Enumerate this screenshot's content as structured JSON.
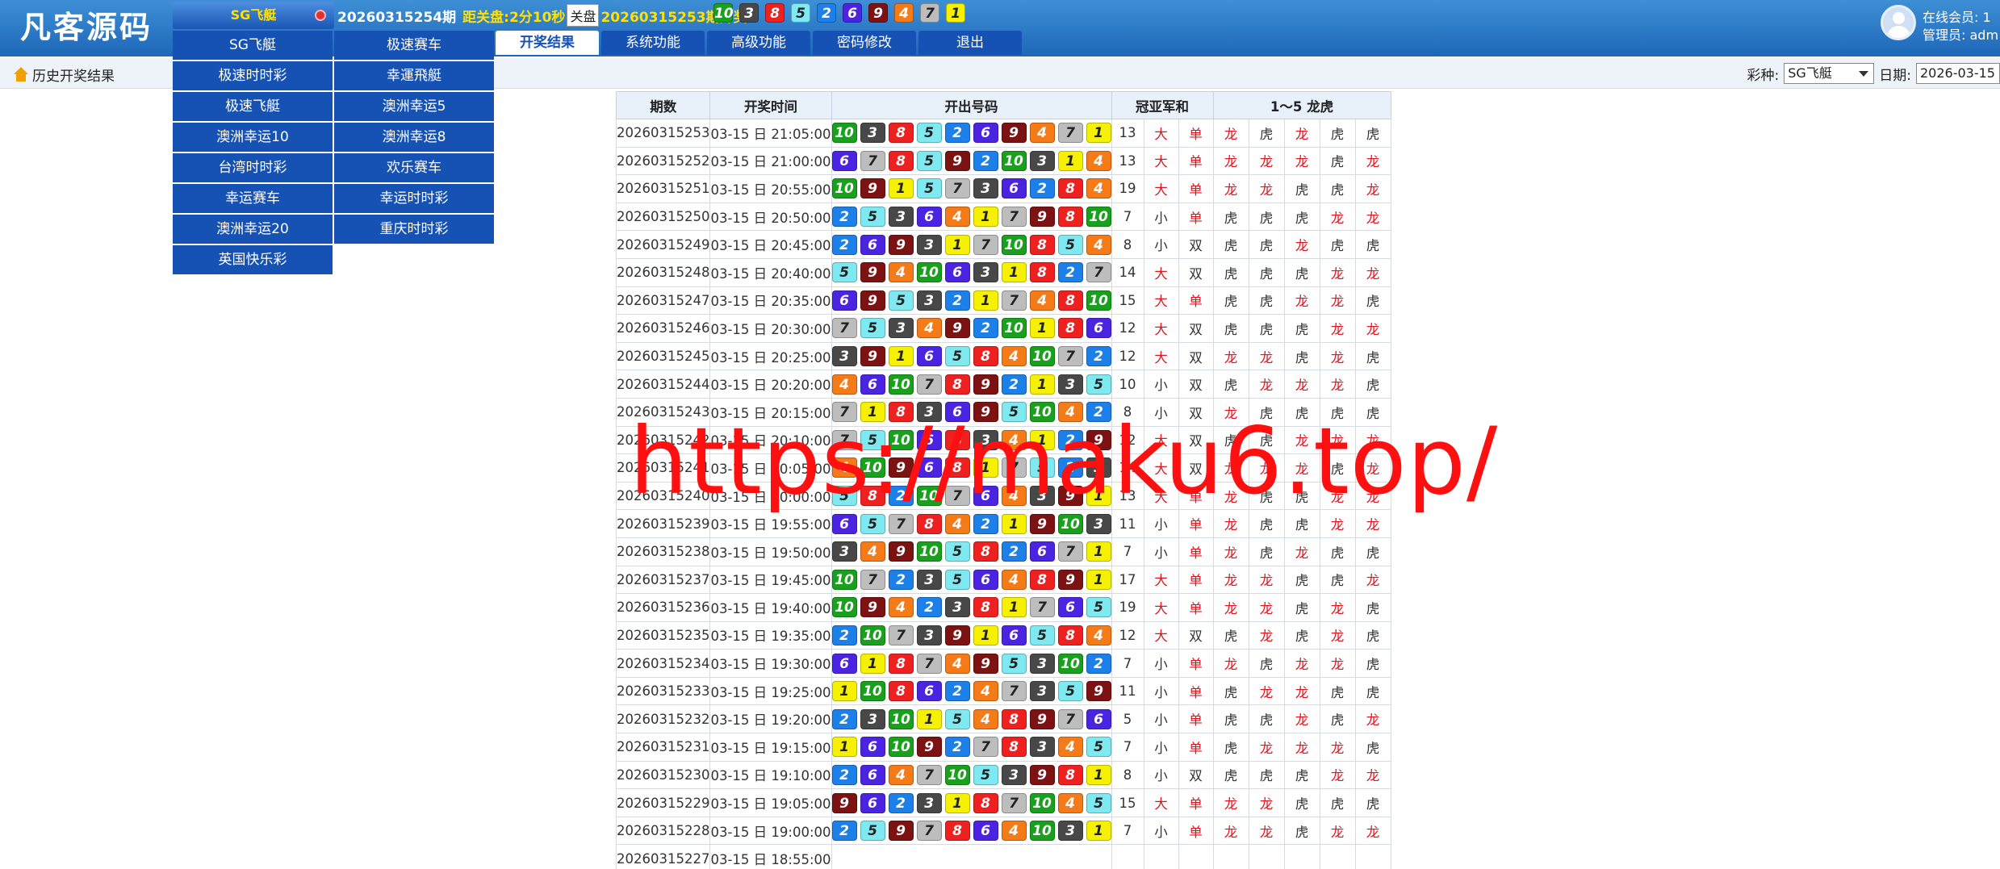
{
  "logo": "凡客源码",
  "header": {
    "game": "SG飞艇",
    "current_period": "20260315254期",
    "countdown_label": "距关盘:",
    "countdown": "2分10秒",
    "close_button": "关盘",
    "last_period": "20260315253期开奖:",
    "last_balls": [
      10,
      3,
      8,
      5,
      2,
      6,
      9,
      4,
      7,
      1
    ],
    "online_label": "在线会员: 1",
    "admin_label": "管理员: adm"
  },
  "nav": {
    "tabs": [
      "开奖结果",
      "系统功能",
      "高级功能",
      "密码修改",
      "退出"
    ],
    "active": 0
  },
  "subbar": {
    "history_link": "历史开奖结果",
    "lottery_label": "彩种:",
    "lottery_value": "SG飞艇",
    "date_label": "日期:",
    "date_value": "2026-03-15"
  },
  "dropdown": [
    "SG飞艇",
    "极速赛车",
    "极速时时彩",
    "幸運飛艇",
    "极速飞艇",
    "澳洲幸运5",
    "澳洲幸运10",
    "澳洲幸运8",
    "台湾时时彩",
    "欢乐赛车",
    "幸运赛车",
    "幸运时时彩",
    "澳洲幸运20",
    "重庆时时彩",
    "英国快乐彩"
  ],
  "table": {
    "headers": [
      "期数",
      "开奖时间",
      "开出号码",
      "冠亚军和",
      "1～5 龙虎"
    ]
  },
  "ball_colors": {
    "1": "#f6f100",
    "2": "#1d7fe8",
    "3": "#484848",
    "4": "#f57a18",
    "5": "#7ee9f0",
    "6": "#4b24e2",
    "7": "#bdbdbd",
    "8": "#ee2020",
    "9": "#7d1212",
    "10": "#19a01d"
  },
  "rows": [
    {
      "period": "20260315253",
      "time": "03-15 日 21:05:00",
      "balls": [
        10,
        3,
        8,
        5,
        2,
        6,
        9,
        4,
        7,
        1
      ],
      "sum": "13",
      "bs": "大",
      "oe": "单",
      "lh": [
        "龙",
        "虎",
        "龙",
        "虎",
        "虎"
      ]
    },
    {
      "period": "20260315252",
      "time": "03-15 日 21:00:00",
      "balls": [
        6,
        7,
        8,
        5,
        9,
        2,
        10,
        3,
        1,
        4
      ],
      "sum": "13",
      "bs": "大",
      "oe": "单",
      "lh": [
        "龙",
        "龙",
        "龙",
        "虎",
        "龙"
      ]
    },
    {
      "period": "20260315251",
      "time": "03-15 日 20:55:00",
      "balls": [
        10,
        9,
        1,
        5,
        7,
        3,
        6,
        2,
        8,
        4
      ],
      "sum": "19",
      "bs": "大",
      "oe": "单",
      "lh": [
        "龙",
        "龙",
        "虎",
        "虎",
        "龙"
      ]
    },
    {
      "period": "20260315250",
      "time": "03-15 日 20:50:00",
      "balls": [
        2,
        5,
        3,
        6,
        4,
        1,
        7,
        9,
        8,
        10
      ],
      "sum": "7",
      "bs": "小",
      "oe": "单",
      "lh": [
        "虎",
        "虎",
        "虎",
        "龙",
        "龙"
      ]
    },
    {
      "period": "20260315249",
      "time": "03-15 日 20:45:00",
      "balls": [
        2,
        6,
        9,
        3,
        1,
        7,
        10,
        8,
        5,
        4
      ],
      "sum": "8",
      "bs": "小",
      "oe": "双",
      "lh": [
        "虎",
        "虎",
        "龙",
        "虎",
        "虎"
      ]
    },
    {
      "period": "20260315248",
      "time": "03-15 日 20:40:00",
      "balls": [
        5,
        9,
        4,
        10,
        6,
        3,
        1,
        8,
        2,
        7
      ],
      "sum": "14",
      "bs": "大",
      "oe": "双",
      "lh": [
        "虎",
        "虎",
        "虎",
        "龙",
        "龙"
      ]
    },
    {
      "period": "20260315247",
      "time": "03-15 日 20:35:00",
      "balls": [
        6,
        9,
        5,
        3,
        2,
        1,
        7,
        4,
        8,
        10
      ],
      "sum": "15",
      "bs": "大",
      "oe": "单",
      "lh": [
        "虎",
        "虎",
        "龙",
        "龙",
        "虎"
      ]
    },
    {
      "period": "20260315246",
      "time": "03-15 日 20:30:00",
      "balls": [
        7,
        5,
        3,
        4,
        9,
        2,
        10,
        1,
        8,
        6
      ],
      "sum": "12",
      "bs": "大",
      "oe": "双",
      "lh": [
        "虎",
        "虎",
        "虎",
        "龙",
        "龙"
      ]
    },
    {
      "period": "20260315245",
      "time": "03-15 日 20:25:00",
      "balls": [
        3,
        9,
        1,
        6,
        5,
        8,
        4,
        10,
        7,
        2
      ],
      "sum": "12",
      "bs": "大",
      "oe": "双",
      "lh": [
        "龙",
        "龙",
        "虎",
        "龙",
        "虎"
      ]
    },
    {
      "period": "20260315244",
      "time": "03-15 日 20:20:00",
      "balls": [
        4,
        6,
        10,
        7,
        8,
        9,
        2,
        1,
        3,
        5
      ],
      "sum": "10",
      "bs": "小",
      "oe": "双",
      "lh": [
        "虎",
        "龙",
        "龙",
        "龙",
        "虎"
      ]
    },
    {
      "period": "20260315243",
      "time": "03-15 日 20:15:00",
      "balls": [
        7,
        1,
        8,
        3,
        6,
        9,
        5,
        10,
        4,
        2
      ],
      "sum": "8",
      "bs": "小",
      "oe": "双",
      "lh": [
        "龙",
        "虎",
        "虎",
        "虎",
        "虎"
      ]
    },
    {
      "period": "20260315242",
      "time": "03-15 日 20:10:00",
      "balls": [
        7,
        5,
        10,
        6,
        8,
        3,
        4,
        1,
        2,
        9
      ],
      "sum": "12",
      "bs": "大",
      "oe": "双",
      "lh": [
        "虎",
        "虎",
        "龙",
        "龙",
        "龙"
      ]
    },
    {
      "period": "20260315241",
      "time": "03-15 日 20:05:00",
      "balls": [
        4,
        10,
        9,
        6,
        8,
        1,
        7,
        5,
        2,
        3
      ],
      "sum": "14",
      "bs": "大",
      "oe": "双",
      "lh": [
        "龙",
        "龙",
        "龙",
        "虎",
        "龙"
      ]
    },
    {
      "period": "20260315240",
      "time": "03-15 日 20:00:00",
      "balls": [
        5,
        8,
        2,
        10,
        7,
        6,
        4,
        3,
        9,
        1
      ],
      "sum": "13",
      "bs": "大",
      "oe": "单",
      "lh": [
        "龙",
        "虎",
        "虎",
        "龙",
        "龙"
      ]
    },
    {
      "period": "20260315239",
      "time": "03-15 日 19:55:00",
      "balls": [
        6,
        5,
        7,
        8,
        4,
        2,
        1,
        9,
        10,
        3
      ],
      "sum": "11",
      "bs": "小",
      "oe": "单",
      "lh": [
        "龙",
        "虎",
        "虎",
        "龙",
        "龙"
      ]
    },
    {
      "period": "20260315238",
      "time": "03-15 日 19:50:00",
      "balls": [
        3,
        4,
        9,
        10,
        5,
        8,
        2,
        6,
        7,
        1
      ],
      "sum": "7",
      "bs": "小",
      "oe": "单",
      "lh": [
        "龙",
        "虎",
        "龙",
        "虎",
        "虎"
      ]
    },
    {
      "period": "20260315237",
      "time": "03-15 日 19:45:00",
      "balls": [
        10,
        7,
        2,
        3,
        5,
        6,
        4,
        8,
        9,
        1
      ],
      "sum": "17",
      "bs": "大",
      "oe": "单",
      "lh": [
        "龙",
        "龙",
        "虎",
        "虎",
        "龙"
      ]
    },
    {
      "period": "20260315236",
      "time": "03-15 日 19:40:00",
      "balls": [
        10,
        9,
        4,
        2,
        3,
        8,
        1,
        7,
        6,
        5
      ],
      "sum": "19",
      "bs": "大",
      "oe": "单",
      "lh": [
        "龙",
        "龙",
        "虎",
        "龙",
        "虎"
      ]
    },
    {
      "period": "20260315235",
      "time": "03-15 日 19:35:00",
      "balls": [
        2,
        10,
        7,
        3,
        9,
        1,
        6,
        5,
        8,
        4
      ],
      "sum": "12",
      "bs": "大",
      "oe": "双",
      "lh": [
        "虎",
        "龙",
        "虎",
        "龙",
        "虎"
      ]
    },
    {
      "period": "20260315234",
      "time": "03-15 日 19:30:00",
      "balls": [
        6,
        1,
        8,
        7,
        4,
        9,
        5,
        3,
        10,
        2
      ],
      "sum": "7",
      "bs": "小",
      "oe": "单",
      "lh": [
        "龙",
        "虎",
        "龙",
        "龙",
        "虎"
      ]
    },
    {
      "period": "20260315233",
      "time": "03-15 日 19:25:00",
      "balls": [
        1,
        10,
        8,
        6,
        2,
        4,
        7,
        3,
        5,
        9
      ],
      "sum": "11",
      "bs": "小",
      "oe": "单",
      "lh": [
        "虎",
        "龙",
        "龙",
        "虎",
        "虎"
      ]
    },
    {
      "period": "20260315232",
      "time": "03-15 日 19:20:00",
      "balls": [
        2,
        3,
        10,
        1,
        5,
        4,
        8,
        9,
        7,
        6
      ],
      "sum": "5",
      "bs": "小",
      "oe": "单",
      "lh": [
        "虎",
        "虎",
        "龙",
        "虎",
        "龙"
      ]
    },
    {
      "period": "20260315231",
      "time": "03-15 日 19:15:00",
      "balls": [
        1,
        6,
        10,
        9,
        2,
        7,
        8,
        3,
        4,
        5
      ],
      "sum": "7",
      "bs": "小",
      "oe": "单",
      "lh": [
        "虎",
        "龙",
        "龙",
        "龙",
        "虎"
      ]
    },
    {
      "period": "20260315230",
      "time": "03-15 日 19:10:00",
      "balls": [
        2,
        6,
        4,
        7,
        10,
        5,
        3,
        9,
        8,
        1
      ],
      "sum": "8",
      "bs": "小",
      "oe": "双",
      "lh": [
        "虎",
        "虎",
        "虎",
        "龙",
        "龙"
      ]
    },
    {
      "period": "20260315229",
      "time": "03-15 日 19:05:00",
      "balls": [
        9,
        6,
        2,
        3,
        1,
        8,
        7,
        10,
        4,
        5
      ],
      "sum": "15",
      "bs": "大",
      "oe": "单",
      "lh": [
        "龙",
        "龙",
        "虎",
        "虎",
        "虎"
      ]
    },
    {
      "period": "20260315228",
      "time": "03-15 日 19:00:00",
      "balls": [
        2,
        5,
        9,
        7,
        8,
        6,
        4,
        10,
        3,
        1
      ],
      "sum": "7",
      "bs": "小",
      "oe": "单",
      "lh": [
        "龙",
        "龙",
        "虎",
        "龙",
        "龙"
      ]
    },
    {
      "period": "20260315227",
      "time": "03-15 日 18:55:00",
      "balls": [],
      "sum": "",
      "bs": "",
      "oe": "",
      "lh": [
        "",
        "",
        "",
        "",
        ""
      ]
    }
  ],
  "watermark": "https://maku6.top/"
}
